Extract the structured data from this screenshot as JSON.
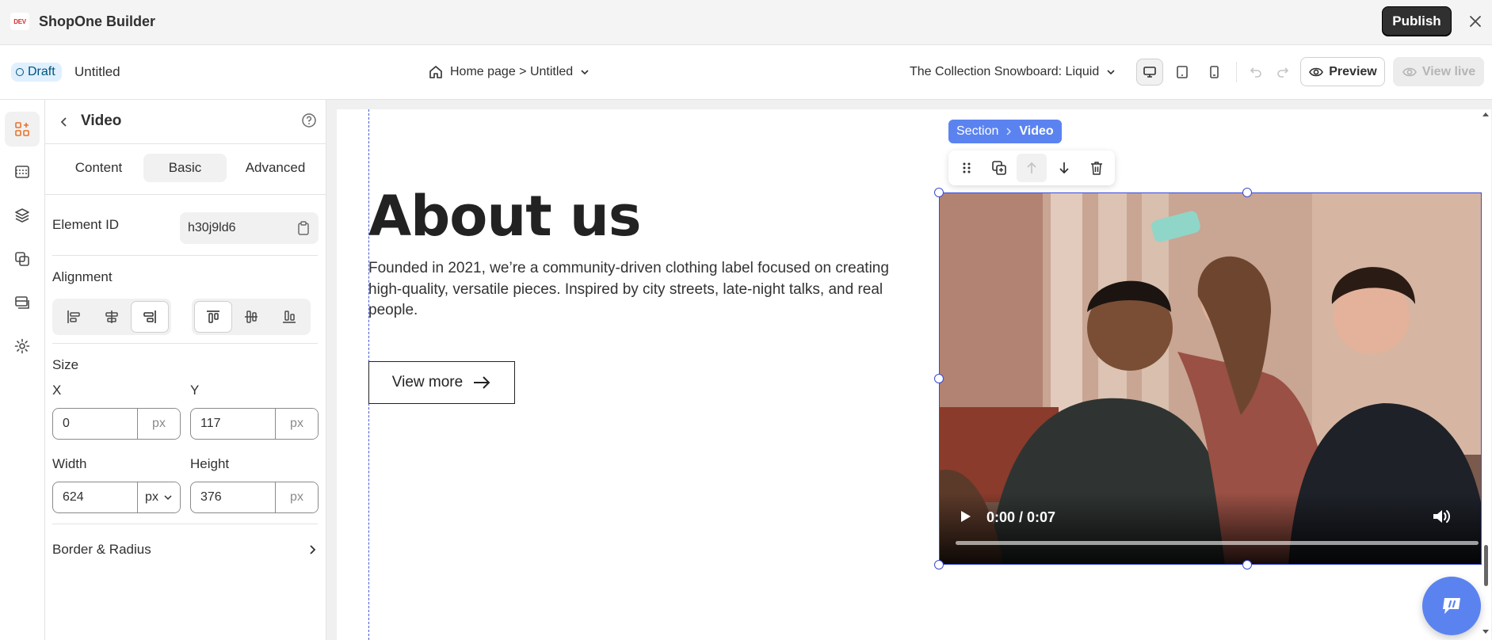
{
  "app": {
    "logo_text": "DEV",
    "title": "ShopOne Builder",
    "publish_label": "Publish"
  },
  "subbar": {
    "status": "Draft",
    "page_name": "Untitled",
    "page_path": "Home page > Untitled",
    "theme_selector": "The Collection Snowboard: Liquid",
    "preview_label": "Preview",
    "view_live_label": "View live"
  },
  "panel": {
    "title": "Video",
    "tabs": [
      {
        "label": "Content",
        "active": false
      },
      {
        "label": "Basic",
        "active": true
      },
      {
        "label": "Advanced",
        "active": false
      }
    ],
    "element_id_label": "Element ID",
    "element_id_value": "h30j9ld6",
    "alignment_label": "Alignment",
    "size_label": "Size",
    "x_label": "X",
    "x_value": "0",
    "x_unit": "px",
    "y_label": "Y",
    "y_value": "117",
    "y_unit": "px",
    "width_label": "Width",
    "width_value": "624",
    "width_unit": "px",
    "height_label": "Height",
    "height_value": "376",
    "height_unit": "px",
    "border_label": "Border & Radius"
  },
  "canvas": {
    "heading": "About us",
    "body": "Founded in 2021, we’re a community-driven clothing label focused on creating high-quality, versatile pieces. Inspired by city streets, late-night talks, and real people.",
    "button_label": "View more",
    "breadcrumb": [
      "Section",
      "Video"
    ],
    "video_time": "0:00 / 0:07",
    "video_progress": 0
  },
  "colors": {
    "accent": "#5b83f0",
    "selection": "#3c4bd2",
    "publish_bg": "#303030",
    "draft_bg": "#e0f0ff"
  }
}
